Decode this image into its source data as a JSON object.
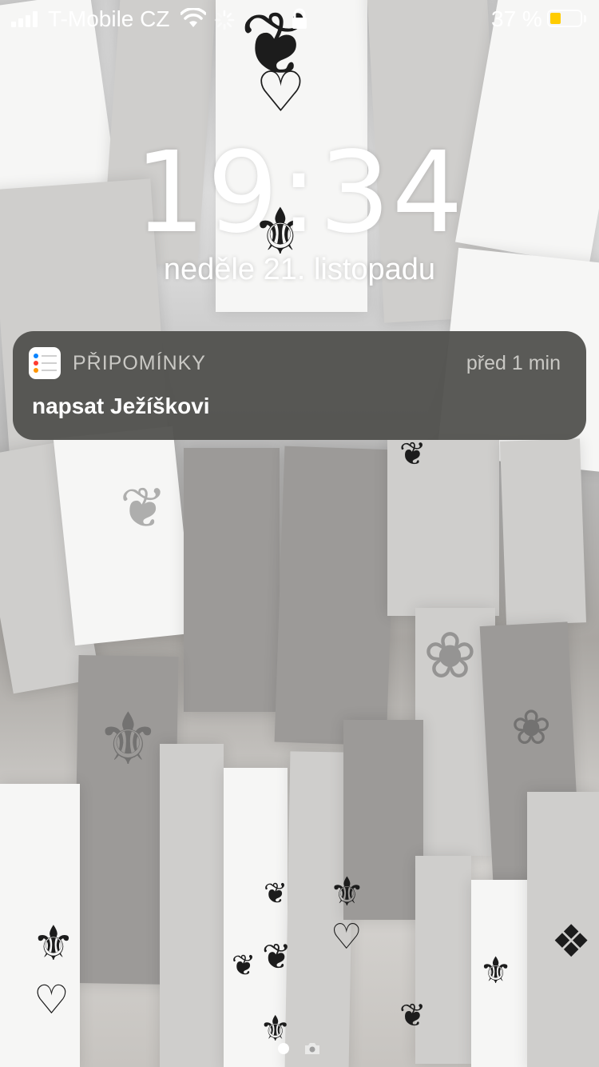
{
  "status_bar": {
    "carrier": "T-Mobile CZ",
    "battery_percent_label": "37 %",
    "battery_level": 0.37,
    "battery_color": "#ffcc00",
    "signal_bars": 4,
    "icons": [
      "signal-icon",
      "wifi-icon",
      "activity-spinner-icon",
      "orientation-lock-icon",
      "battery-icon"
    ]
  },
  "lock_screen": {
    "time": "19:34",
    "date": "neděle 21. listopadu"
  },
  "notification": {
    "app_name": "PŘIPOMÍNKY",
    "time": "před 1 min",
    "body": "napsat Ježíškovi",
    "app_icon": "reminders-icon",
    "background": "#50504c"
  },
  "page_indicator": {
    "icons": [
      "page-dot",
      "camera-icon"
    ]
  }
}
